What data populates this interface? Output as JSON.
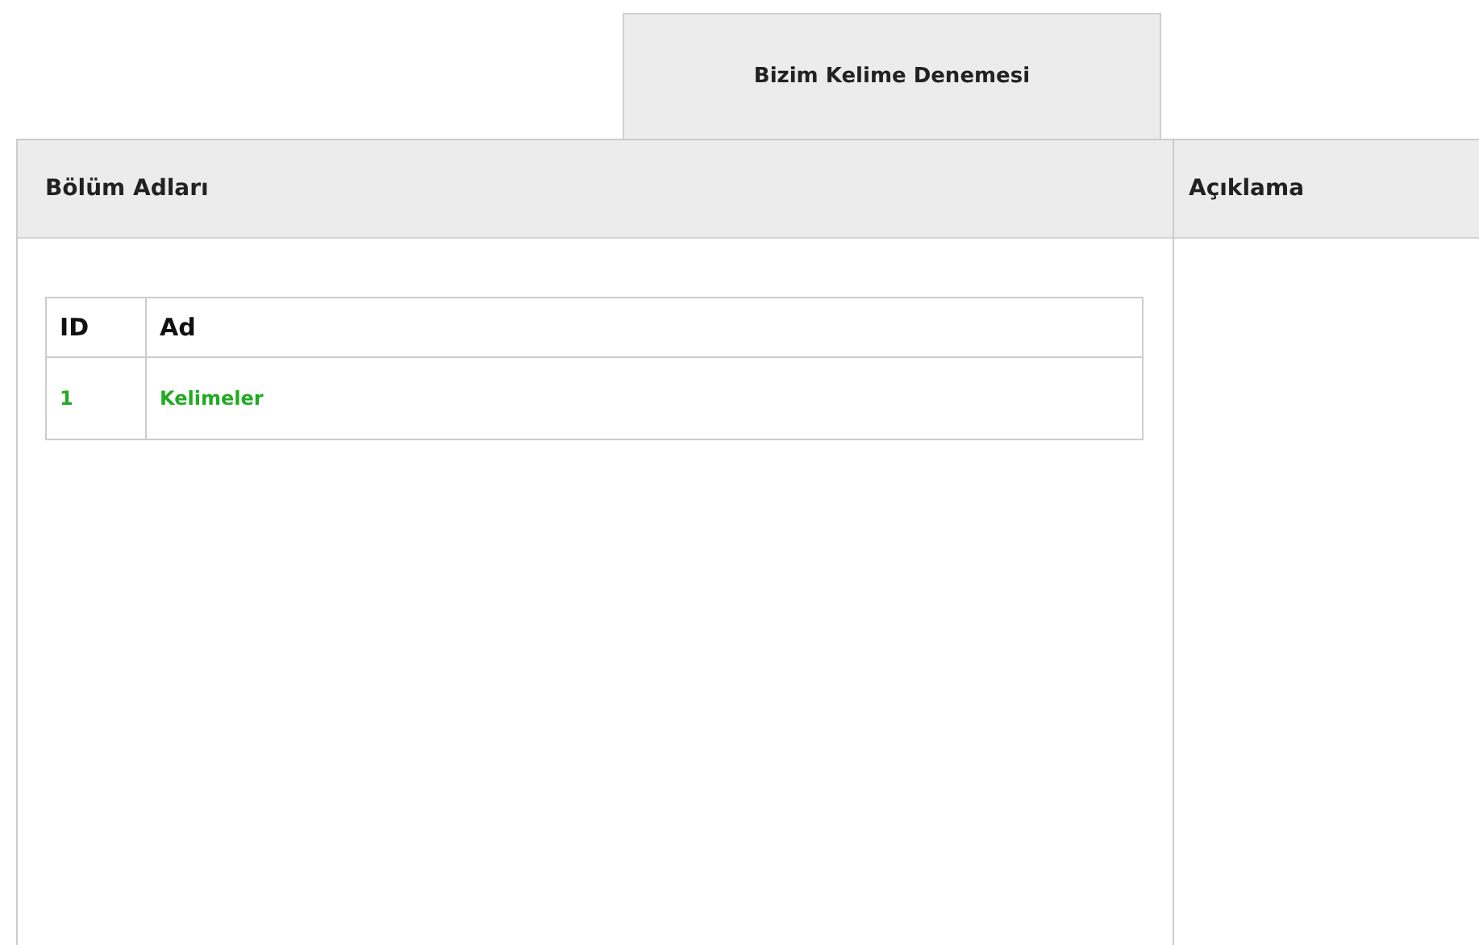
{
  "tabs": [
    {
      "label": "Bizim Kelime Denemesi",
      "selected": true
    }
  ],
  "columns": [
    {
      "heading": "Bölüm Adları"
    },
    {
      "heading": "Açıklama"
    }
  ],
  "table": {
    "columns": [
      "ID",
      "Ad"
    ],
    "rows": [
      {
        "id": "1",
        "name": "Kelimeler"
      }
    ]
  }
}
